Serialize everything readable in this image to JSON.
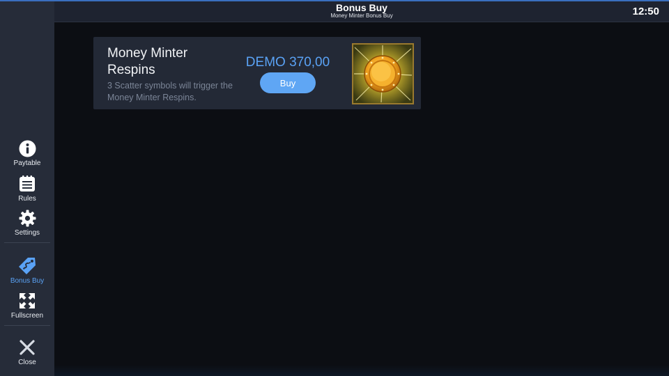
{
  "header": {
    "title": "Bonus Buy",
    "subtitle": "Money Minter Bonus Buy",
    "clock": "12:50"
  },
  "sidebar": {
    "items": [
      {
        "label": "Paytable",
        "icon": "info-icon"
      },
      {
        "label": "Rules",
        "icon": "rules-list-icon"
      },
      {
        "label": "Settings",
        "icon": "gear-icon"
      },
      {
        "label": "Bonus Buy",
        "icon": "price-tag-icon",
        "active": true
      },
      {
        "label": "Fullscreen",
        "icon": "fullscreen-icon"
      },
      {
        "label": "Close",
        "icon": "close-icon"
      }
    ]
  },
  "card": {
    "title": "Money Minter Respins",
    "description": "3 Scatter symbols will trigger the Money Minter Respins.",
    "price": "DEMO 370,00",
    "buy_label": "Buy",
    "image": "gold-coin-icon"
  },
  "colors": {
    "accent": "#5aa2f5",
    "sidebar_bg": "#262c39",
    "card_bg": "#232936",
    "page_bg": "#0c0e13"
  }
}
